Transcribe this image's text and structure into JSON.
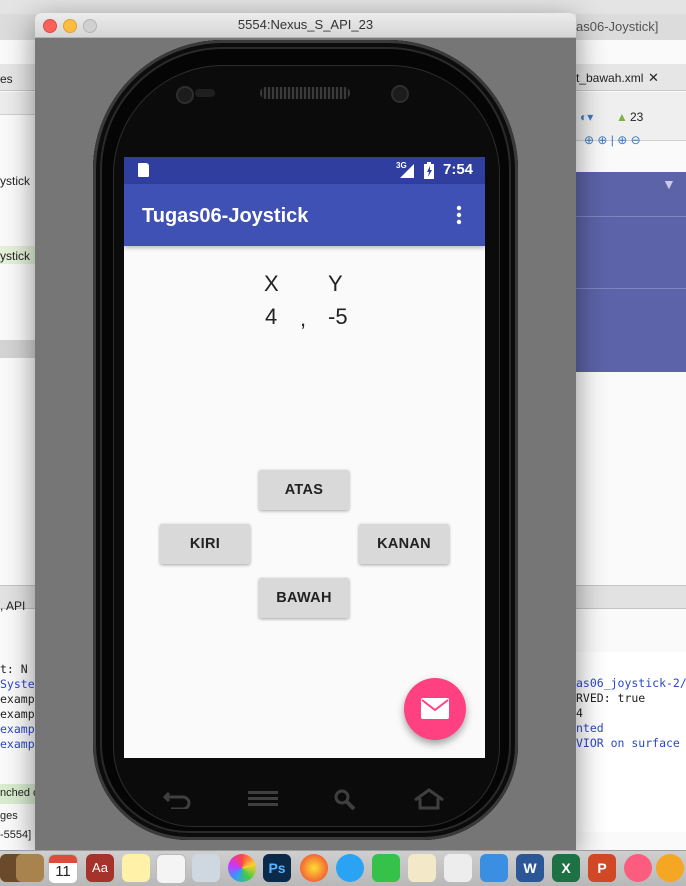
{
  "emulator": {
    "window_title": "5554:Nexus_S_API_23",
    "status_bar": {
      "network": "3G",
      "time": "7:54"
    },
    "app": {
      "title": "Tugas06-Joystick",
      "x_label": "X",
      "y_label": "Y",
      "x_value": "4",
      "separator": ",",
      "y_value": "-5",
      "buttons": {
        "up": "ATAS",
        "left": "KIRI",
        "right": "KANAN",
        "down": "BAWAH"
      },
      "fab_icon": "mail-icon"
    },
    "nav_keys": [
      "back-icon",
      "menu-icon",
      "search-icon",
      "home-icon"
    ]
  },
  "ide": {
    "window_title_fragment": "as06-Joystick]",
    "left_fragments": [
      "es",
      "ystick",
      "ystick",
      ", API",
      "t: N",
      "System",
      "exampl",
      "exampl",
      "exampl",
      "exampl",
      "nched c",
      "ges",
      "-5554]"
    ],
    "right_tab": "t_bawah.xml",
    "api_level": "23",
    "console_right": [
      "as06_joystick-2/",
      "RVED: true",
      "4",
      "nted",
      "VIOR on surface"
    ]
  },
  "dock_badge": "11",
  "colors": {
    "status_bar": "#303f9f",
    "app_bar": "#3f51b5",
    "fab": "#ff4081",
    "button": "#d9d9d9"
  }
}
